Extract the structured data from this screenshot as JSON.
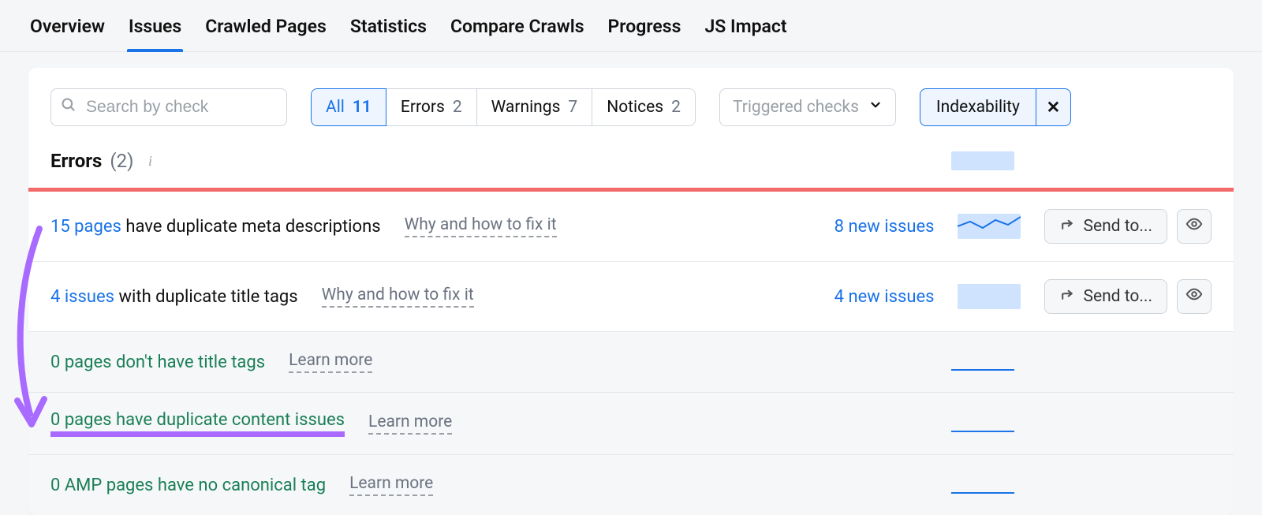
{
  "tabs": [
    "Overview",
    "Issues",
    "Crawled Pages",
    "Statistics",
    "Compare Crawls",
    "Progress",
    "JS Impact"
  ],
  "active_tab": "Issues",
  "search": {
    "placeholder": "Search by check",
    "value": ""
  },
  "filter_segments": [
    {
      "label": "All",
      "count": 11,
      "active": true
    },
    {
      "label": "Errors",
      "count": 2,
      "active": false
    },
    {
      "label": "Warnings",
      "count": 7,
      "active": false
    },
    {
      "label": "Notices",
      "count": 2,
      "active": false
    }
  ],
  "dropdown": {
    "label": "Triggered checks"
  },
  "active_filter_chip": {
    "label": "Indexability"
  },
  "section": {
    "title": "Errors",
    "count_label": "(2)"
  },
  "rows": [
    {
      "kind": "issue",
      "count_text": "15 pages",
      "rest_text": " have duplicate meta descriptions",
      "hint": "Why and how to fix it",
      "new_issues": "8 new issues",
      "send_to": "Send to..."
    },
    {
      "kind": "issue",
      "count_text": "4 issues",
      "rest_text": " with duplicate title tags",
      "hint": "Why and how to fix it",
      "new_issues": "4 new issues",
      "send_to": "Send to..."
    },
    {
      "kind": "passed",
      "full_text": "0 pages don't have title tags",
      "hint": "Learn more"
    },
    {
      "kind": "passed",
      "full_text": "0 pages have duplicate content issues",
      "hint": "Learn more",
      "highlight": true
    },
    {
      "kind": "passed",
      "full_text": "0 AMP pages have no canonical tag",
      "hint": "Learn more"
    }
  ]
}
